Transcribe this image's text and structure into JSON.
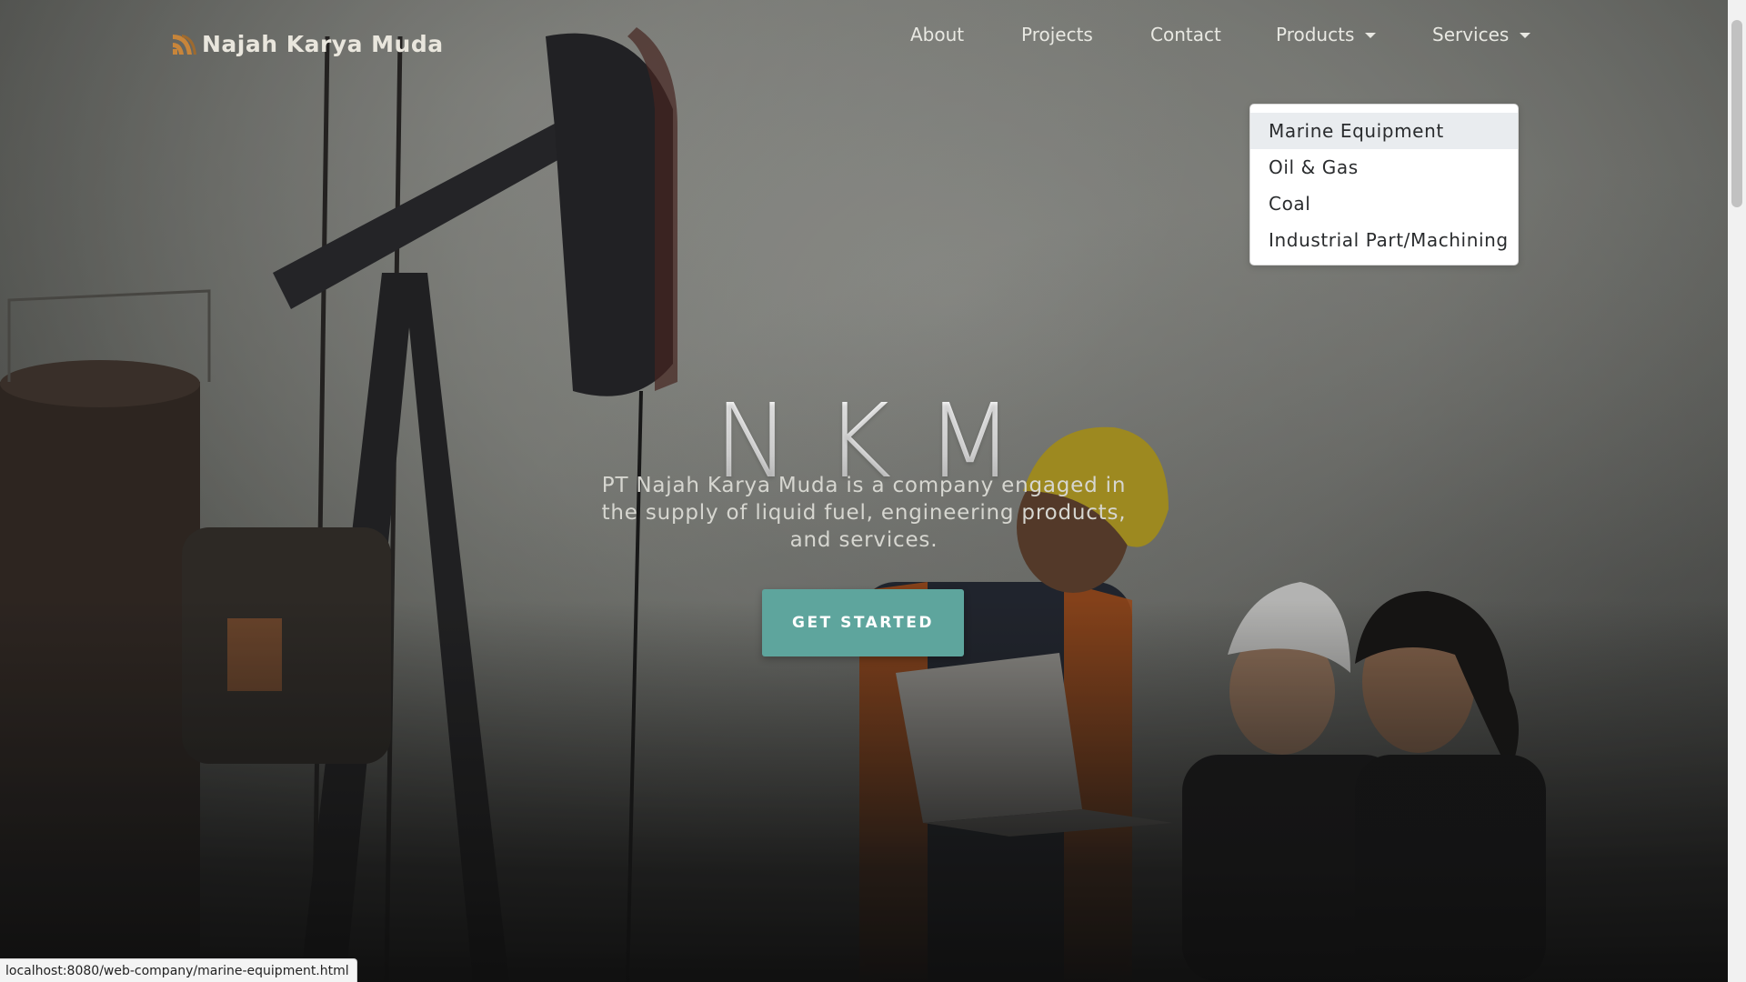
{
  "brand": {
    "name": "Najah Karya Muda",
    "logo_icon": "rss-like-logo-icon",
    "logo_color": "#c8853a"
  },
  "nav": {
    "about": "About",
    "projects": "Projects",
    "contact": "Contact",
    "products": "Products",
    "services": "Services"
  },
  "services_menu": {
    "items": [
      {
        "label": "Marine Equipment",
        "hovered": true
      },
      {
        "label": "Oil & Gas"
      },
      {
        "label": "Coal"
      },
      {
        "label": "Industrial Part/Machining"
      }
    ]
  },
  "hero": {
    "title": "NKM",
    "subtitle": "PT Najah Karya Muda is a company engaged in the supply of liquid fuel, engineering products, and services.",
    "cta": "GET STARTED",
    "cta_color": "#5ea59d"
  },
  "status_bar": {
    "url": "localhost:8080/web-company/marine-equipment.html"
  }
}
